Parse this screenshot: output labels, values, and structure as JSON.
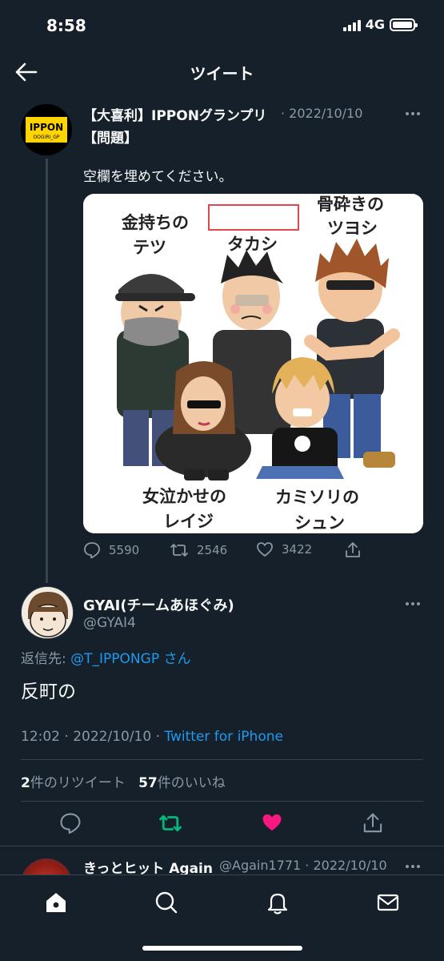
{
  "status_bar": {
    "time": "8:58",
    "network": "4G"
  },
  "header": {
    "title": "ツイート"
  },
  "parent_tweet": {
    "author_name": "【大喜利】IPPONグランプリ",
    "date": "· 2022/10/10",
    "author_name_line2": "【問題】",
    "text": "空欄を埋めてください。",
    "avatar_text": "IPPON",
    "avatar_subtext": "OOGIRI_GP",
    "image": {
      "labels": {
        "tetsu_1": "金持ちの",
        "tetsu_2": "テツ",
        "takashi": "タカシ",
        "tsuyoshi_1": "骨砕きの",
        "tsuyoshi_2": "ツヨシ",
        "reiji_1": "女泣かせの",
        "reiji_2": "レイジ",
        "shun_1": "カミソリの",
        "shun_2": "シュン"
      },
      "blank_box_color": "#e0464b"
    },
    "replies": "5590",
    "retweets": "2546",
    "likes": "3422"
  },
  "reply_tweet": {
    "author_name": "GYAI(チームあほぐみ)",
    "handle": "@GYAI4",
    "replying_prefix": "返信先: ",
    "replying_to": "@T_IPPONGP",
    "replying_suffix": " さん",
    "text": "反町の",
    "time_date": "12:02 · 2022/10/10 · ",
    "source": "Twitter for iPhone",
    "retweet_count": "2",
    "retweet_label": "件のリツイート",
    "like_count": "57",
    "like_label": "件のいいね"
  },
  "next_tweet": {
    "author_name": "きっとヒット Again",
    "handle_date": "@Again1771 · 2022/10/10"
  },
  "colors": {
    "background": "#15202b",
    "link": "#1d9bf0",
    "retweet_green": "#00ba7c",
    "like_pink": "#f91880",
    "muted": "#8b98a5"
  },
  "icons": {
    "back": "arrow-left-icon",
    "reply": "comment-icon",
    "retweet": "retweet-icon",
    "like": "heart-icon",
    "share": "share-icon",
    "home": "home-icon",
    "search": "search-icon",
    "notifications": "bell-icon",
    "messages": "mail-icon"
  }
}
